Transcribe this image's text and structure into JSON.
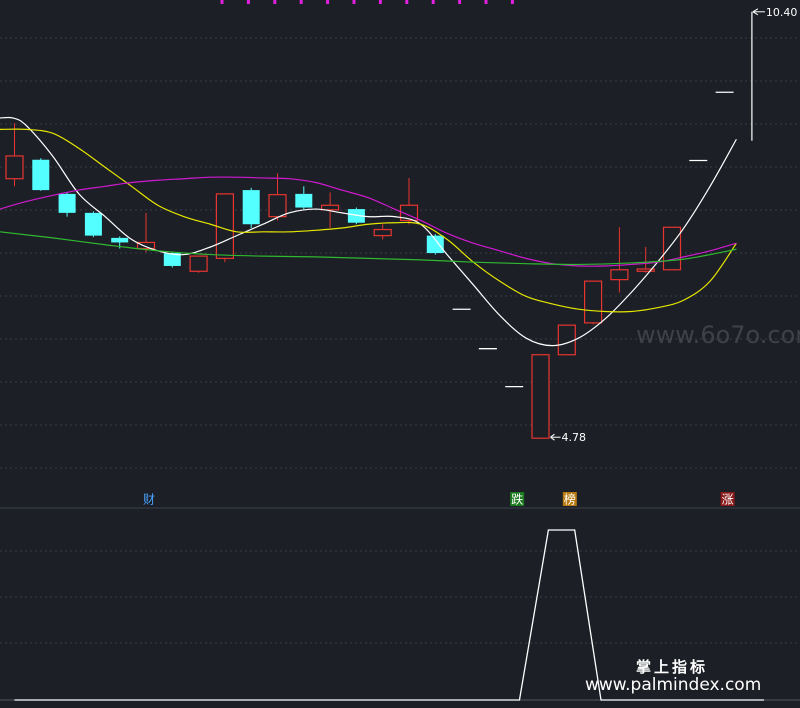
{
  "chart_data": [
    {
      "type": "candlestick",
      "yscale": [
        4.15,
        10.45
      ],
      "annotations": {
        "high_label": "10.40",
        "low_label": "4.78"
      },
      "candles": [
        {
          "o": 8.5,
          "h": 8.93,
          "l": 8.1,
          "c": 8.2,
          "color": "red"
        },
        {
          "o": 8.45,
          "h": 8.47,
          "l": 8.04,
          "c": 8.05,
          "color": "cyan"
        },
        {
          "o": 8.0,
          "h": 8.02,
          "l": 7.7,
          "c": 7.75,
          "color": "cyan"
        },
        {
          "o": 7.75,
          "h": 7.77,
          "l": 7.43,
          "c": 7.45,
          "color": "cyan"
        },
        {
          "o": 7.42,
          "h": 7.44,
          "l": 7.28,
          "c": 7.36,
          "color": "cyan"
        },
        {
          "o": 7.28,
          "h": 7.75,
          "l": 7.23,
          "c": 7.36,
          "color": "red"
        },
        {
          "o": 7.22,
          "h": 7.24,
          "l": 7.03,
          "c": 7.05,
          "color": "cyan"
        },
        {
          "o": 6.98,
          "h": 7.18,
          "l": 6.96,
          "c": 7.18,
          "color": "red"
        },
        {
          "o": 7.15,
          "h": 8.0,
          "l": 7.1,
          "c": 8.0,
          "color": "red"
        },
        {
          "o": 8.05,
          "h": 8.08,
          "l": 7.55,
          "c": 7.6,
          "color": "cyan"
        },
        {
          "o": 7.7,
          "h": 8.27,
          "l": 7.65,
          "c": 7.99,
          "color": "red"
        },
        {
          "o": 8.0,
          "h": 8.1,
          "l": 7.8,
          "c": 7.82,
          "color": "cyan"
        },
        {
          "o": 7.85,
          "h": 8.02,
          "l": 7.55,
          "c": 7.79,
          "color": "red"
        },
        {
          "o": 7.8,
          "h": 7.82,
          "l": 7.6,
          "c": 7.62,
          "color": "cyan"
        },
        {
          "o": 7.45,
          "h": 7.6,
          "l": 7.4,
          "c": 7.53,
          "color": "red"
        },
        {
          "o": 7.65,
          "h": 8.21,
          "l": 7.6,
          "c": 7.85,
          "color": "red"
        },
        {
          "o": 7.45,
          "h": 7.47,
          "l": 7.2,
          "c": 7.22,
          "color": "cyan"
        },
        {
          "o": null,
          "h": 6.48,
          "l": 6.48,
          "c": null,
          "color": "white",
          "dash": true
        },
        {
          "o": null,
          "h": 5.96,
          "l": 5.96,
          "c": null,
          "color": "white",
          "dash": true
        },
        {
          "o": null,
          "h": 5.46,
          "l": 5.46,
          "c": null,
          "color": "white",
          "dash": true
        },
        {
          "o": 4.78,
          "h": 5.88,
          "l": 4.78,
          "c": 5.88,
          "color": "red"
        },
        {
          "o": 5.88,
          "h": 6.27,
          "l": 5.88,
          "c": 6.27,
          "color": "red"
        },
        {
          "o": 6.3,
          "h": 6.85,
          "l": 6.28,
          "c": 6.85,
          "color": "red"
        },
        {
          "o": 6.87,
          "h": 7.56,
          "l": 6.7,
          "c": 7.0,
          "color": "red"
        },
        {
          "o": 6.98,
          "h": 7.3,
          "l": 6.96,
          "c": 7.01,
          "color": "red"
        },
        {
          "o": 7.0,
          "h": 7.56,
          "l": 7.0,
          "c": 7.56,
          "color": "red"
        },
        {
          "o": null,
          "h": 8.44,
          "l": 8.44,
          "c": null,
          "color": "white",
          "dash": true
        },
        {
          "o": null,
          "h": 9.34,
          "l": 9.34,
          "c": null,
          "color": "white",
          "dash": true
        },
        {
          "o": 8.7,
          "h": 10.4,
          "l": 8.7,
          "c": 10.4,
          "color": "white",
          "line": true
        }
      ],
      "ma_lines": [
        {
          "color": "#ffffff",
          "points": [
            [
              0,
              9.0
            ],
            [
              0.5,
              9.0
            ],
            [
              1,
              8.9
            ],
            [
              2,
              8.5
            ],
            [
              3,
              8.0
            ],
            [
              4,
              7.7
            ],
            [
              5,
              7.4
            ],
            [
              6,
              7.25
            ],
            [
              7,
              7.2
            ],
            [
              8,
              7.3
            ],
            [
              9,
              7.45
            ],
            [
              10,
              7.6
            ],
            [
              11,
              7.75
            ],
            [
              12,
              7.8
            ],
            [
              13,
              7.75
            ],
            [
              14,
              7.7
            ],
            [
              15,
              7.7
            ],
            [
              16,
              7.6
            ],
            [
              17,
              7.2
            ],
            [
              18,
              6.8
            ],
            [
              19,
              6.4
            ],
            [
              20,
              6.1
            ],
            [
              21,
              6.0
            ],
            [
              22,
              6.1
            ],
            [
              23,
              6.35
            ],
            [
              24,
              6.7
            ],
            [
              25,
              7.1
            ],
            [
              26,
              7.55
            ],
            [
              27,
              8.1
            ],
            [
              28,
              8.72
            ]
          ]
        },
        {
          "color": "#e6e600",
          "points": [
            [
              0,
              8.85
            ],
            [
              1,
              8.85
            ],
            [
              2,
              8.8
            ],
            [
              3,
              8.6
            ],
            [
              4,
              8.35
            ],
            [
              5,
              8.1
            ],
            [
              6,
              7.85
            ],
            [
              7,
              7.7
            ],
            [
              8,
              7.6
            ],
            [
              9,
              7.5
            ],
            [
              10,
              7.5
            ],
            [
              11,
              7.5
            ],
            [
              12,
              7.52
            ],
            [
              13,
              7.55
            ],
            [
              14,
              7.6
            ],
            [
              15,
              7.62
            ],
            [
              16,
              7.6
            ],
            [
              17,
              7.4
            ],
            [
              18,
              7.1
            ],
            [
              19,
              6.85
            ],
            [
              20,
              6.65
            ],
            [
              21,
              6.55
            ],
            [
              22,
              6.48
            ],
            [
              23,
              6.45
            ],
            [
              24,
              6.45
            ],
            [
              25,
              6.5
            ],
            [
              26,
              6.6
            ],
            [
              27,
              6.85
            ],
            [
              28,
              7.35
            ]
          ]
        },
        {
          "color": "#d01ad0",
          "points": [
            [
              0,
              7.8
            ],
            [
              1,
              7.9
            ],
            [
              2,
              7.98
            ],
            [
              3,
              8.05
            ],
            [
              4,
              8.1
            ],
            [
              5,
              8.15
            ],
            [
              6,
              8.18
            ],
            [
              7,
              8.2
            ],
            [
              8,
              8.22
            ],
            [
              9,
              8.22
            ],
            [
              10,
              8.21
            ],
            [
              11,
              8.2
            ],
            [
              12,
              8.15
            ],
            [
              13,
              8.05
            ],
            [
              14,
              7.95
            ],
            [
              15,
              7.8
            ],
            [
              16,
              7.65
            ],
            [
              17,
              7.48
            ],
            [
              18,
              7.35
            ],
            [
              19,
              7.25
            ],
            [
              20,
              7.15
            ],
            [
              21,
              7.08
            ],
            [
              22,
              7.05
            ],
            [
              23,
              7.05
            ],
            [
              24,
              7.07
            ],
            [
              25,
              7.1
            ],
            [
              26,
              7.17
            ],
            [
              27,
              7.25
            ],
            [
              28,
              7.35
            ]
          ]
        },
        {
          "color": "#30b830",
          "points": [
            [
              0,
              7.5
            ],
            [
              2,
              7.42
            ],
            [
              4,
              7.33
            ],
            [
              6,
              7.25
            ],
            [
              8,
              7.2
            ],
            [
              10,
              7.18
            ],
            [
              12,
              7.17
            ],
            [
              14,
              7.15
            ],
            [
              16,
              7.13
            ],
            [
              18,
              7.1
            ],
            [
              20,
              7.08
            ],
            [
              22,
              7.07
            ],
            [
              24,
              7.09
            ],
            [
              26,
              7.14
            ],
            [
              28,
              7.27
            ]
          ]
        }
      ],
      "markers": [
        {
          "index": 5,
          "text": "财",
          "text_color": "#4aa3ff",
          "bg": "#1c1f26"
        },
        {
          "index": 19,
          "text": "跌",
          "text_color": "#ffffff",
          "bg": "#1e7a1e"
        },
        {
          "index": 21,
          "text": "榜",
          "text_color": "#ffffff",
          "bg": "#b87a10"
        },
        {
          "index": 27,
          "text": "涨",
          "text_color": "#ffffff",
          "bg": "#8a1a1a"
        }
      ],
      "top_ticks": {
        "color": "#e020e0",
        "count": 12
      }
    },
    {
      "type": "line",
      "yscale": [
        0,
        1
      ],
      "color": "#ffffff",
      "points": [
        [
          0,
          0
        ],
        [
          19.2,
          0
        ],
        [
          20.3,
          1
        ],
        [
          21.3,
          1
        ],
        [
          22.3,
          0
        ],
        [
          28.5,
          0
        ]
      ]
    }
  ],
  "watermarks": {
    "brand_cn": "掌上指标",
    "brand_url": "www.palmindex.com",
    "faint": "www.6o7o.com"
  }
}
